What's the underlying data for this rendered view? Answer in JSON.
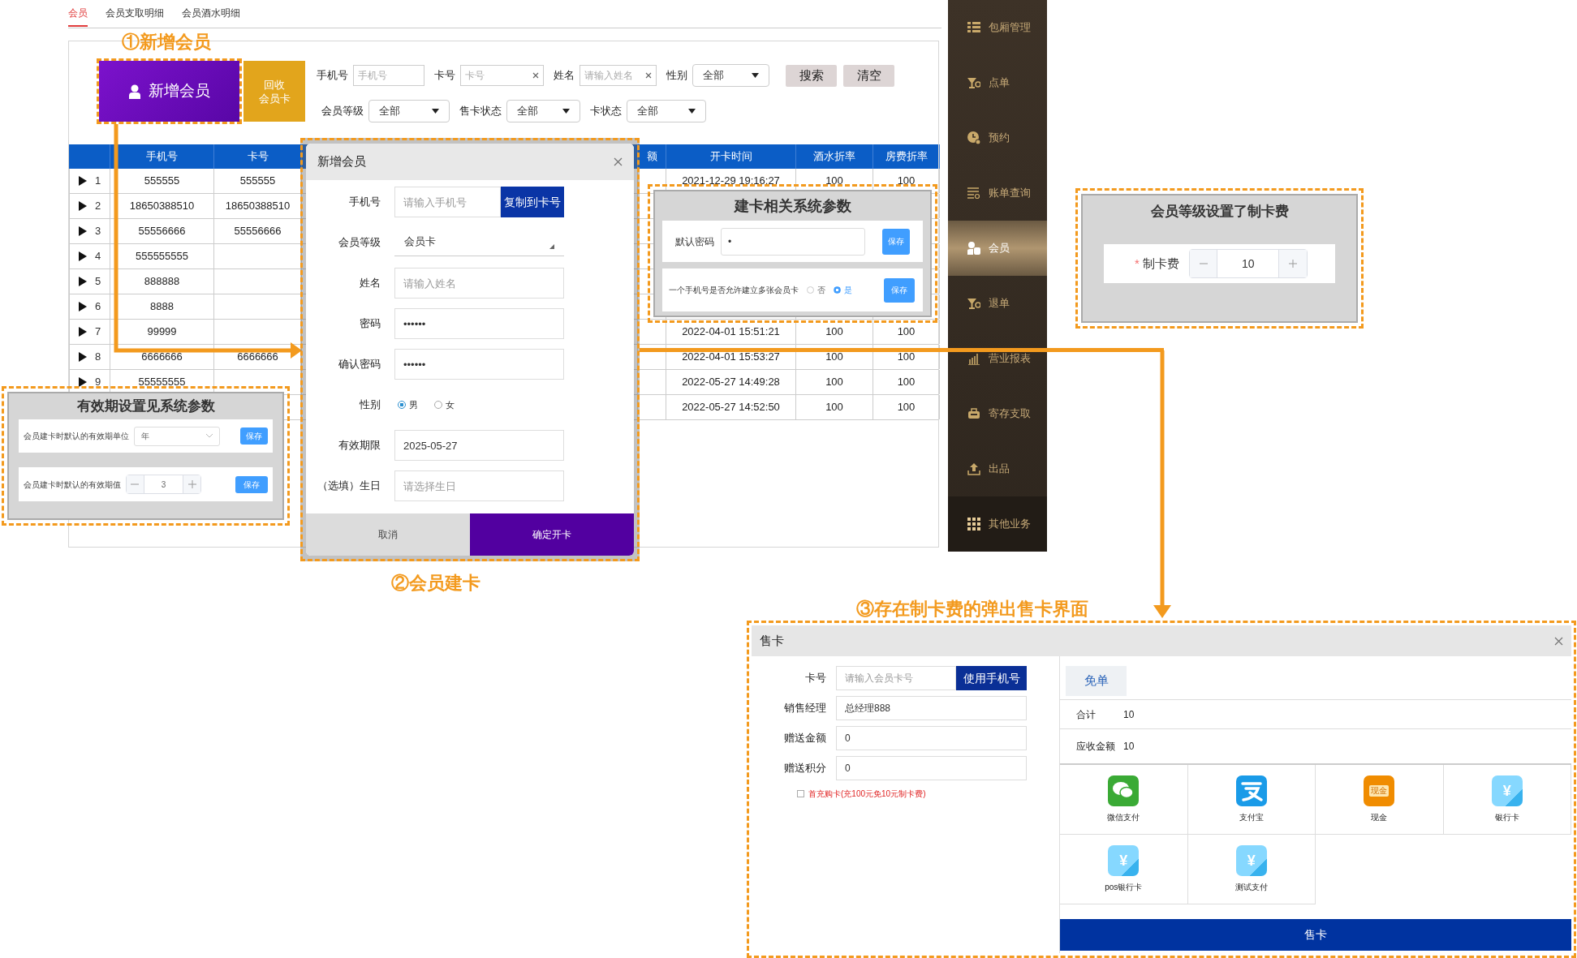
{
  "tabs": [
    {
      "label": "会员",
      "selected": true
    },
    {
      "label": "会员支取明细",
      "selected": false
    },
    {
      "label": "会员酒水明细",
      "selected": false
    }
  ],
  "toolbar": {
    "add_member_button": "新增会员",
    "recycle_card_button": [
      "回收",
      "会员卡"
    ],
    "add_member_note": "①新增会员"
  },
  "filters": [
    [
      {
        "label": "手机号",
        "kind": "input",
        "placeholder": "手机号",
        "clearable": false
      },
      {
        "label": "卡号",
        "kind": "input",
        "placeholder": "卡号",
        "clearable": true
      },
      {
        "label": "姓名",
        "kind": "input",
        "placeholder": "请输入姓名",
        "clearable": true
      },
      {
        "label": "性别",
        "kind": "select",
        "value": "全部"
      }
    ],
    [
      {
        "label": "会员等级",
        "kind": "select",
        "value": "全部"
      },
      {
        "label": "售卡状态",
        "kind": "select",
        "value": "全部"
      },
      {
        "label": "卡状态",
        "kind": "select",
        "value": "全部"
      }
    ]
  ],
  "filter_buttons": [
    "搜索",
    "清空"
  ],
  "table": {
    "columns": [
      "手机号",
      "卡号",
      "额",
      "开卡时间",
      "酒水折率",
      "房费折率"
    ],
    "rows": [
      {
        "index": "1",
        "cells": [
          "555555",
          "555555",
          null,
          "2021-12-29 19:16:27",
          "100",
          "100"
        ]
      },
      {
        "index": "2",
        "cells": [
          "18650388510",
          "18650388510",
          null,
          null,
          null,
          null
        ]
      },
      {
        "index": "3",
        "cells": [
          "55556666",
          "55556666",
          null,
          null,
          null,
          null
        ]
      },
      {
        "index": "4",
        "cells": [
          "555555555",
          null,
          null,
          null,
          null,
          null
        ]
      },
      {
        "index": "5",
        "cells": [
          "888888",
          null,
          null,
          null,
          null,
          null
        ]
      },
      {
        "index": "6",
        "cells": [
          "8888",
          null,
          null,
          null,
          null,
          null
        ]
      },
      {
        "index": "7",
        "cells": [
          "99999",
          null,
          null,
          "2022-04-01 15:51:21",
          "100",
          "100"
        ]
      },
      {
        "index": "8",
        "cells": [
          "6666666",
          "6666666",
          null,
          "2022-04-01 15:53:27",
          "100",
          "100"
        ]
      },
      {
        "index": "9",
        "cells": [
          "55555555",
          null,
          null,
          "2022-05-27 14:49:28",
          "100",
          "100"
        ]
      },
      {
        "index": null,
        "cells": [
          null,
          null,
          null,
          "2022-05-27 14:52:50",
          "100",
          "100"
        ]
      }
    ]
  },
  "sidebar": [
    {
      "label": "包厢管理",
      "selected": false
    },
    {
      "label": "点单",
      "selected": false
    },
    {
      "label": "预约",
      "selected": false
    },
    {
      "label": "账单查询",
      "selected": false
    },
    {
      "label": "会员",
      "selected": true
    },
    {
      "label": "退单",
      "selected": false
    },
    {
      "label": "营业报表",
      "selected": false
    },
    {
      "label": "寄存支取",
      "selected": false
    },
    {
      "label": "出品",
      "selected": false
    },
    {
      "label": "其他业务",
      "selected": false
    }
  ],
  "create_card_dialog": {
    "title": "新增会员",
    "note": "②会员建卡",
    "fields": [
      {
        "label": "手机号",
        "kind": "input",
        "placeholder": "请输入手机号",
        "button": "复制到卡号"
      },
      {
        "label": "会员等级",
        "kind": "select",
        "value": "会员卡"
      },
      {
        "label": "姓名",
        "kind": "input",
        "placeholder": "请输入姓名"
      },
      {
        "label": "密码",
        "kind": "input",
        "value": "••••••"
      },
      {
        "label": "确认密码",
        "kind": "input",
        "value": "••••••"
      },
      {
        "label": "性别",
        "kind": "radio",
        "options": [
          {
            "label": "男",
            "selected": true
          },
          {
            "label": "女",
            "selected": false
          }
        ]
      },
      {
        "label": "有效期限",
        "kind": "input",
        "value": "2025-05-27"
      },
      {
        "label": "（选填）生日",
        "kind": "input",
        "placeholder": "请选择生日"
      }
    ],
    "cancel_button": "取消",
    "confirm_button": "确定开卡"
  },
  "system_params_panel": {
    "title": "建卡相关系统参数",
    "password_label": "默认密码",
    "password_value": "•",
    "password_save": "保存",
    "multi_card_label": "一个手机号是否允许建立多张会员卡",
    "options": [
      {
        "label": "否",
        "selected": false
      },
      {
        "label": "是",
        "selected": true
      }
    ],
    "multi_card_save": "保存"
  },
  "card_fee_panel": {
    "title": "会员等级设置了制卡费",
    "label": "制卡费",
    "required_mark": "*",
    "value": "10"
  },
  "validity_panel": {
    "title": "有效期设置见系统参数",
    "unit_label": "会员建卡时默认的有效期单位",
    "unit_value": "年",
    "unit_save": "保存",
    "value_label": "会员建卡时默认的有效期值",
    "value": "3",
    "value_save": "保存"
  },
  "sale_dialog": {
    "note": "③存在制卡费的弹出售卡界面",
    "title": "售卡",
    "fields": [
      {
        "label": "卡号",
        "placeholder": "请输入会员卡号",
        "button": "使用手机号"
      },
      {
        "label": "销售经理",
        "value": "总经理888"
      },
      {
        "label": "赠送金额",
        "value": "0"
      },
      {
        "label": "赠送积分",
        "value": "0"
      }
    ],
    "first_charge": {
      "label": "首充购卡(充100元免10元制卡费)",
      "checked": false
    },
    "free_button": "免单",
    "summary": [
      {
        "label": "合计",
        "value": "10"
      },
      {
        "label": "应收金额",
        "value": "10"
      }
    ],
    "payments": [
      {
        "kind": "wechat",
        "label": "微信支付"
      },
      {
        "kind": "alipay",
        "label": "支付宝"
      },
      {
        "kind": "cash",
        "label": "现金",
        "badge": "现金"
      },
      {
        "kind": "bank",
        "label": "银行卡",
        "badge": "¥"
      },
      {
        "kind": "bank",
        "label": "pos银行卡",
        "badge": "¥"
      },
      {
        "kind": "bank",
        "label": "测试支付",
        "badge": "¥"
      }
    ],
    "submit_button": "售卡"
  }
}
